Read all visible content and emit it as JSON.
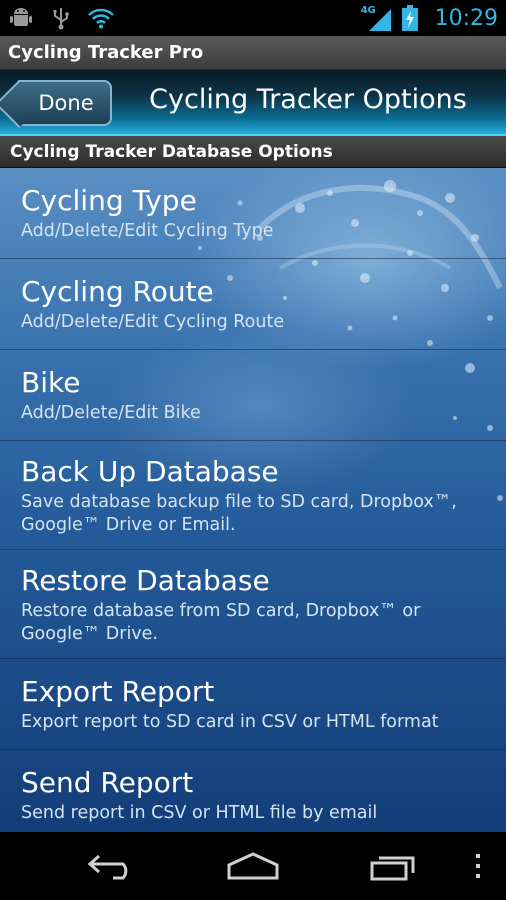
{
  "status_bar": {
    "time": "10:29",
    "network": "4G",
    "icons": [
      "android-debug-icon",
      "usb-icon",
      "wifi-icon",
      "signal-icon",
      "battery-charging-icon"
    ]
  },
  "app": {
    "title": "Cycling Tracker Pro"
  },
  "header": {
    "done_label": "Done",
    "title": "Cycling Tracker Options"
  },
  "section": {
    "title": "Cycling Tracker Database Options"
  },
  "options": [
    {
      "title": "Cycling Type",
      "subtitle": "Add/Delete/Edit Cycling Type"
    },
    {
      "title": "Cycling Route",
      "subtitle": "Add/Delete/Edit Cycling Route"
    },
    {
      "title": "Bike",
      "subtitle": "Add/Delete/Edit Bike"
    },
    {
      "title": "Back Up Database",
      "subtitle": "Save database backup file to SD card, Dropbox™, Google™ Drive or Email."
    },
    {
      "title": "Restore Database",
      "subtitle": "Restore database from SD card, Dropbox™ or Google™ Drive."
    },
    {
      "title": "Export Report",
      "subtitle": "Export report to SD card in CSV or HTML format"
    },
    {
      "title": "Send Report",
      "subtitle": "Send report in CSV or HTML file by email"
    }
  ],
  "nav_bar": {
    "icons": [
      "back-icon",
      "home-icon",
      "recent-apps-icon",
      "overflow-menu-icon"
    ]
  },
  "colors": {
    "accent": "#33b5e5",
    "header_glow": "#25b0dc",
    "content_bg": "#245a99"
  }
}
